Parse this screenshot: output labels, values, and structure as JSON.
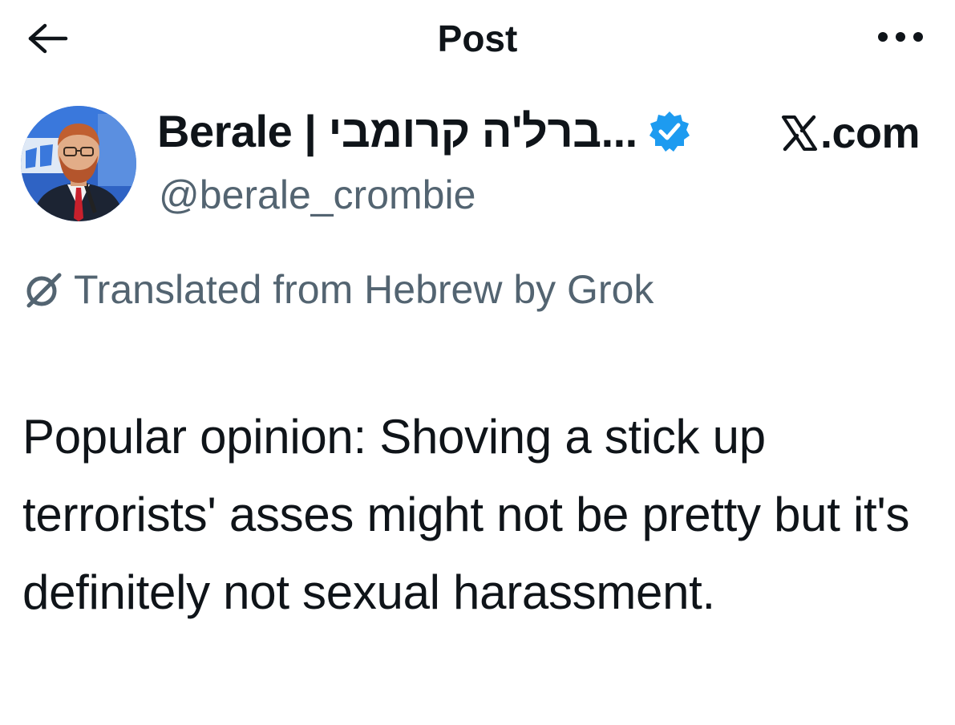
{
  "header": {
    "title": "Post",
    "back_icon": "arrow-left-icon",
    "more_icon": "more-horizontal-icon"
  },
  "author": {
    "display_name": "Berale | ברל'ה קרומבי...",
    "handle": "@berale_crombie",
    "verified": true,
    "verified_color": "#1d9bf0"
  },
  "source": {
    "label": ".com",
    "icon": "x-logo-icon"
  },
  "translation": {
    "text": "Translated from Hebrew by Grok",
    "icon": "grok-icon"
  },
  "post": {
    "text": "Popular opinion: Shoving a stick up terrorists' asses might not be pretty but it's definitely not sexual harassment."
  },
  "colors": {
    "text_primary": "#0f1419",
    "text_secondary": "#536471",
    "background": "#ffffff"
  }
}
